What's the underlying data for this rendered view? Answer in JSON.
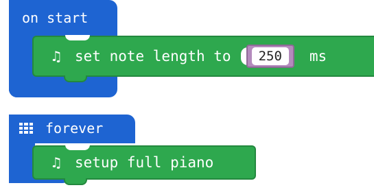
{
  "on_start": {
    "label": "on start",
    "statement": {
      "icon": "music-note-icon",
      "text": "set note length to",
      "value": "250",
      "unit": "ms"
    }
  },
  "forever": {
    "icon": "grid-icon",
    "label": "forever",
    "statement": {
      "icon": "music-note-icon",
      "text": "setup full piano"
    }
  },
  "colors": {
    "event_block": "#1e64d2",
    "music_block": "#2ea84e",
    "music_block_border": "#23883e",
    "reporter": "#b48bbd"
  }
}
